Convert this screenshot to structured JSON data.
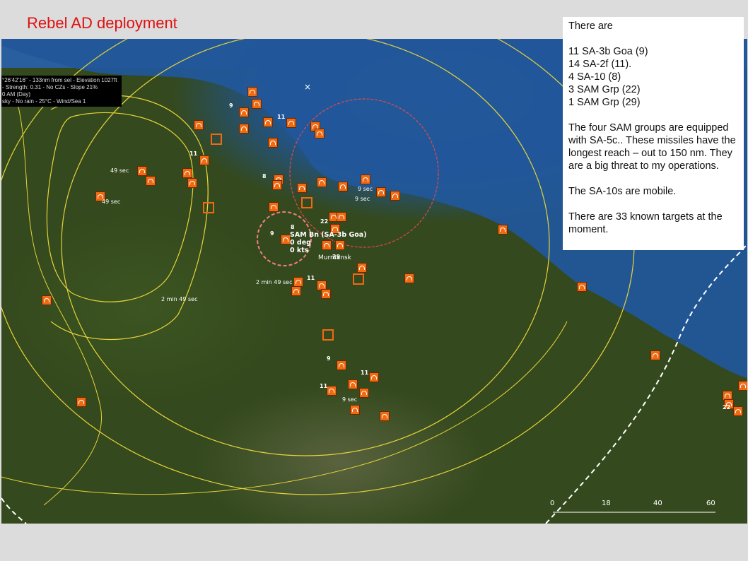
{
  "slide": {
    "title": "Rebel AD deployment"
  },
  "map_info": {
    "line1": "°26'42'16\" - 133nm from sel - Elevation 1027ft",
    "line2": "- Strength: 0.31 - No CZs - Slope 21%",
    "line3": "0 AM (Day)",
    "line4": "sky - No rain - 25°C - Wind/Sea 1"
  },
  "textbox": {
    "intro": "There are",
    "units": [
      "11 SA-3b Goa (9)",
      "14 SA-2f (11).",
      "4 SA-10 (8)",
      "3 SAM Grp (22)",
      "1 SAM Grp (29)"
    ],
    "para1": "The four SAM groups are equipped with SA-5c..  These missiles have the longest reach – out to 150 nm.  They are a big threat to my operations.",
    "para2": "The SA-10s are mobile.",
    "para3": "There are 33 known targets at the moment."
  },
  "selected_unit": {
    "name": "SAM Bn (SA-3b Goa)",
    "heading": "0 deg",
    "speed": "0 kts"
  },
  "places": {
    "city": "Murmansk"
  },
  "time_labels": [
    "49 sec",
    "49 sec",
    "2 min 49 sec",
    "2 min 49 sec",
    "9 sec",
    "9 sec",
    "9 sec"
  ],
  "unit_counts": [
    "9",
    "11",
    "11",
    "8",
    "8",
    "9",
    "22",
    "29",
    "11",
    "9",
    "11",
    "11",
    "22"
  ],
  "scale_bar": [
    "0",
    "18",
    "40",
    "60"
  ],
  "colors": {
    "title": "#e01010",
    "unit_fill": "#f06a12",
    "range_ring": "#e6d23a",
    "sa5_ring": "#e04a4a"
  }
}
